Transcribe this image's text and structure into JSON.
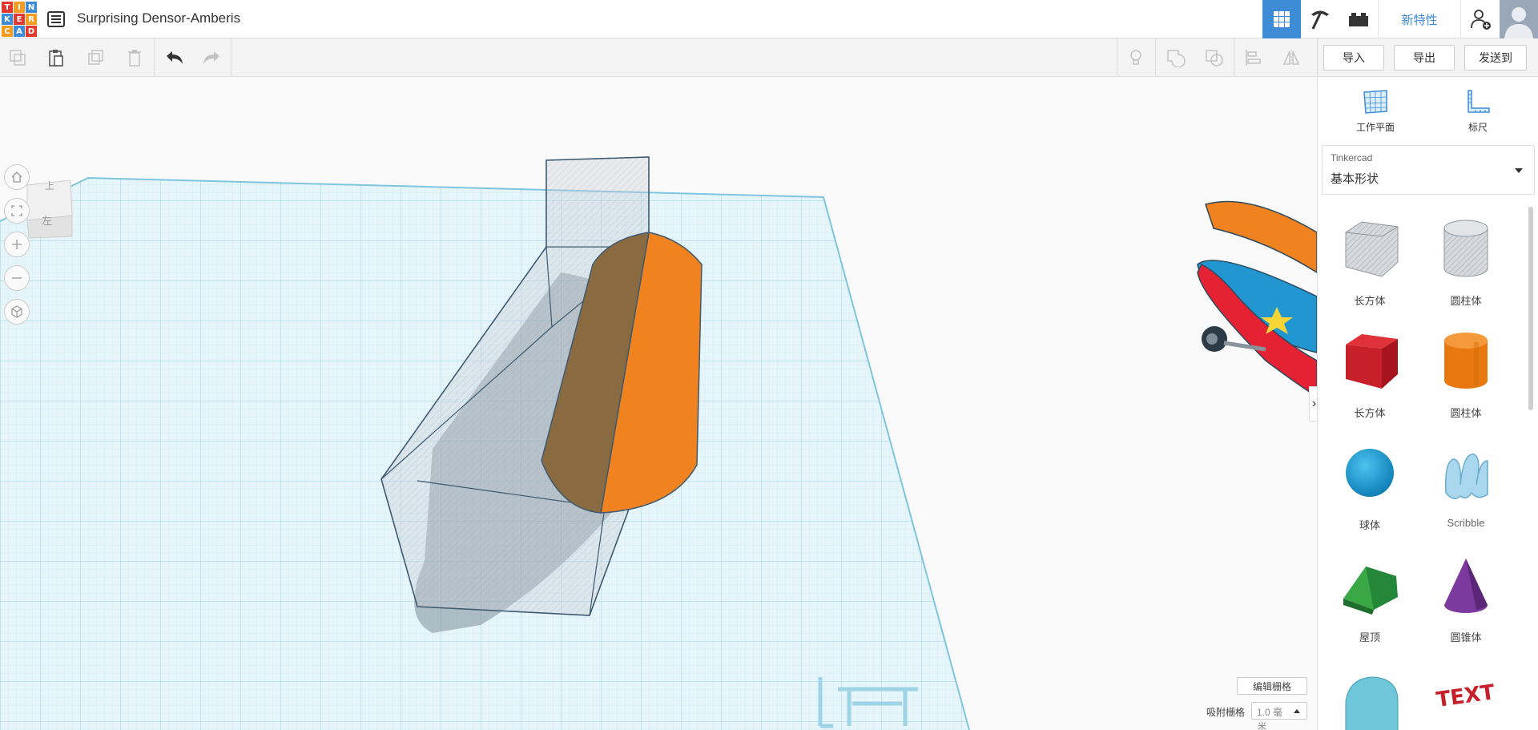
{
  "app": {
    "logo_letters": [
      "T",
      "I",
      "N",
      "K",
      "E",
      "R",
      "C",
      "A",
      "D"
    ],
    "logo_colors": [
      "#e2382f",
      "#f39c21",
      "#3e8bd8",
      "#3e8bd8",
      "#e2382f",
      "#f39c21",
      "#f39c21",
      "#3e8bd8",
      "#e2382f"
    ],
    "title": "Surprising Densor-Amberis",
    "new_features": "新特性"
  },
  "toolbar": {
    "import": "导入",
    "export": "导出",
    "send_to": "发送到"
  },
  "viewcube": {
    "top_face": "上",
    "front_face": "左"
  },
  "sidebar": {
    "workplane": "工作平面",
    "ruler": "标尺",
    "library_owner": "Tinkercad",
    "library_name": "基本形状",
    "shapes": [
      {
        "label": "长方体",
        "icon": "box-hole-icon"
      },
      {
        "label": "圆柱体",
        "icon": "cylinder-hole-icon"
      },
      {
        "label": "长方体",
        "icon": "box-icon"
      },
      {
        "label": "圆柱体",
        "icon": "cylinder-icon"
      },
      {
        "label": "球体",
        "icon": "sphere-icon"
      },
      {
        "label": "Scribble",
        "icon": "scribble-icon"
      },
      {
        "label": "屋顶",
        "icon": "roof-icon"
      },
      {
        "label": "圆锥体",
        "icon": "cone-icon"
      }
    ]
  },
  "grid": {
    "edit_grid": "编辑栅格",
    "snap_label": "吸附栅格",
    "snap_value": "1.0 毫",
    "snap_unit": "米"
  },
  "colors": {
    "accent": "#3e8bd8",
    "orange": "#f0821f",
    "grid": "#b8e3f0"
  }
}
